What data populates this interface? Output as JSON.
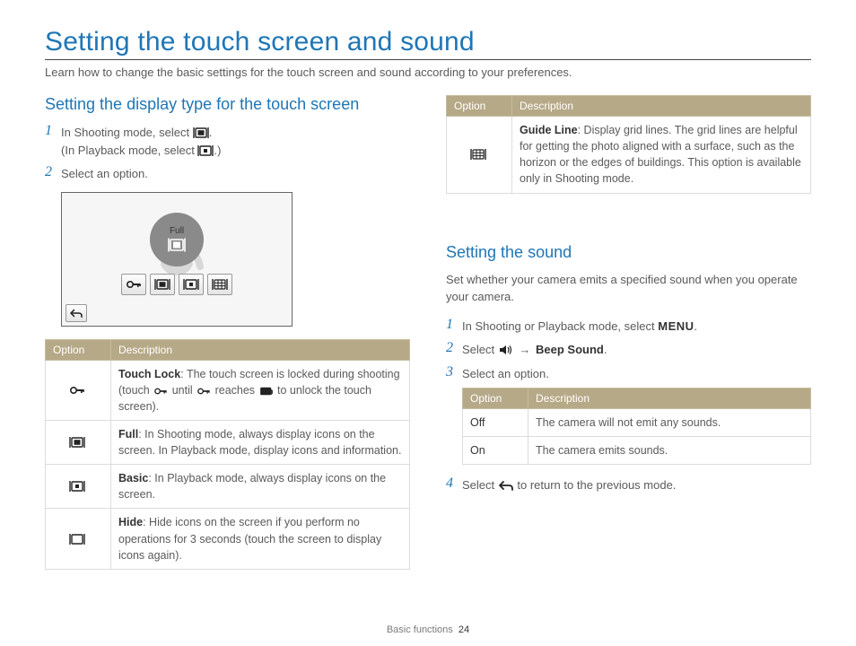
{
  "title": "Setting the touch screen and sound",
  "intro": "Learn how to change the basic settings for the touch screen and sound according to your preferences.",
  "left": {
    "heading": "Setting the display type for the touch screen",
    "step1a": "In Shooting mode, select ",
    "step1b": "(In Playback mode, select ",
    "step1c": ".)",
    "step2": "Select an option.",
    "fig_label": "Full",
    "th_option": "Option",
    "th_desc": "Description",
    "row1_b": "Touch Lock",
    "row1_t": ": The touch screen is locked during shooting (touch ",
    "row1_t2": " until ",
    "row1_t3": " reaches ",
    "row1_t4": " to unlock the touch screen).",
    "row2_b": "Full",
    "row2_t": ": In Shooting mode, always display icons on the screen. In Playback mode, display icons and information.",
    "row3_b": "Basic",
    "row3_t": ": In Playback mode, always display icons on the screen.",
    "row4_b": "Hide",
    "row4_t": ": Hide icons on the screen if you perform no operations for 3 seconds (touch the screen to display icons again)."
  },
  "right": {
    "top_table": {
      "th_option": "Option",
      "th_desc": "Description",
      "row_b": "Guide Line",
      "row_t": ": Display grid lines. The grid lines are helpful for getting the photo aligned with a surface, such as the horizon or the edges of buildings. This option is available only in Shooting mode."
    },
    "heading": "Setting the sound",
    "sub": "Set whether your camera emits a specified sound when you operate your camera.",
    "step1": "In Shooting or Playback mode, select ",
    "menu_label": "MENU",
    "step2a": "Select ",
    "step2_arrow": "→",
    "step2b": "Beep Sound",
    "step3": "Select an option.",
    "sound_table": {
      "th_option": "Option",
      "th_desc": "Description",
      "off_label": "Off",
      "off_desc": "The camera will not emit any sounds.",
      "on_label": "On",
      "on_desc": "The camera emits sounds."
    },
    "step4a": "Select ",
    "step4b": " to return to the previous mode."
  },
  "footer": {
    "section": "Basic functions",
    "page": "24"
  }
}
